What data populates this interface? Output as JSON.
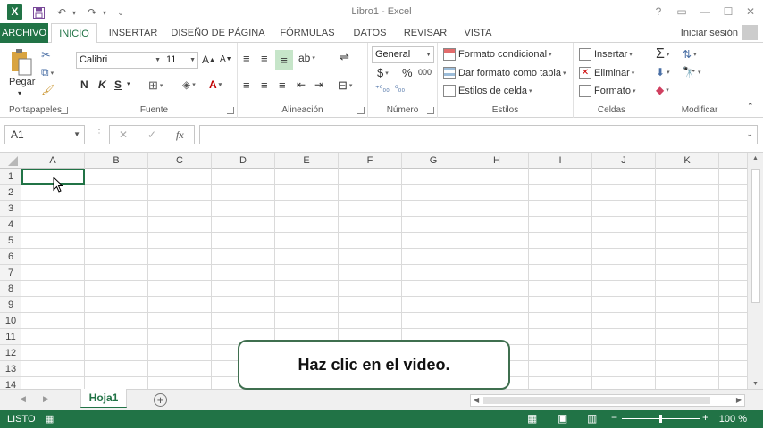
{
  "window": {
    "title": "Libro1 - Excel",
    "app_logo": "X",
    "help_label": "?",
    "signin_label": "Iniciar sesión"
  },
  "tabs": [
    "ARCHIVO",
    "INICIO",
    "INSERTAR",
    "DISEÑO DE PÁGINA",
    "FÓRMULAS",
    "DATOS",
    "REVISAR",
    "VISTA"
  ],
  "ribbon": {
    "portapapeles": {
      "label": "Portapapeles",
      "paste_label": "Pegar"
    },
    "fuente": {
      "label": "Fuente",
      "font_name": "Calibri",
      "font_size": "11",
      "bold": "N",
      "italic": "K",
      "underline": "S"
    },
    "alineacion": {
      "label": "Alineación"
    },
    "numero": {
      "label": "Número",
      "format": "General",
      "currency": "$",
      "percent": "%",
      "thousands": "000"
    },
    "estilos": {
      "label": "Estilos",
      "conditional": "Formato condicional",
      "as_table": "Dar formato como tabla",
      "cell_styles": "Estilos de celda"
    },
    "celdas": {
      "label": "Celdas",
      "insert": "Insertar",
      "delete": "Eliminar",
      "format": "Formato"
    },
    "modificar": {
      "label": "Modificar",
      "sum": "Σ"
    }
  },
  "formula_bar": {
    "name_box": "A1",
    "fx_label": "fx",
    "formula": ""
  },
  "grid": {
    "columns": [
      "A",
      "B",
      "C",
      "D",
      "E",
      "F",
      "G",
      "H",
      "I",
      "J",
      "K"
    ],
    "rows": [
      "1",
      "2",
      "3",
      "4",
      "5",
      "6",
      "7",
      "8",
      "9",
      "10",
      "11",
      "12",
      "13",
      "14"
    ],
    "selected_cell": "A1"
  },
  "sheet": {
    "tab_name": "Hoja1",
    "add_sheet": "+"
  },
  "status": {
    "text": "LISTO",
    "zoom": "100 %"
  },
  "callout": {
    "text": "Haz clic en el video."
  },
  "colors": {
    "accent": "#217346",
    "grid_line": "#dadada",
    "header_bg": "#f3f3f3"
  }
}
